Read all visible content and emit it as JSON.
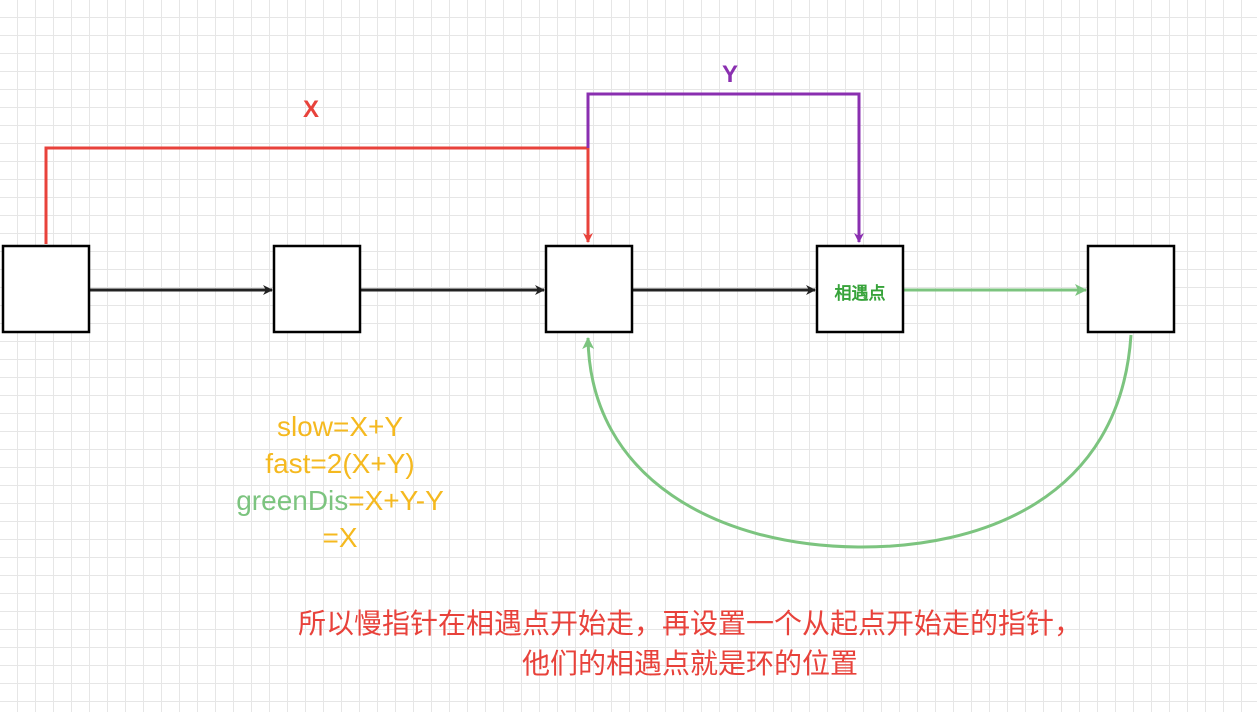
{
  "diagram": {
    "label_x": "X",
    "label_y": "Y",
    "meeting_point": "相遇点"
  },
  "formulas": {
    "slow": "slow=X+Y",
    "fast": "fast=2(X+Y)",
    "green_prefix": "greenDis",
    "green_rest": "=X+Y-Y",
    "result": "=X"
  },
  "explanation": {
    "line1": "所以慢指针在相遇点开始走，再设置一个从起点开始走的指针，",
    "line2": "他们的相遇点就是环的位置"
  },
  "colors": {
    "x_path": "#e8423b",
    "y_path": "#8a2fb0",
    "loop": "#7cc47f",
    "formula": "#f5b91f",
    "note": "#e8423b"
  }
}
